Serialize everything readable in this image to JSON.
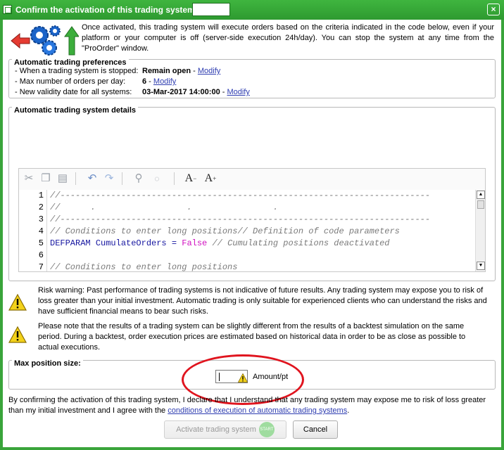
{
  "window": {
    "title": "Confirm the activation of this trading system",
    "close_label": "×"
  },
  "intro": {
    "text": "Once activated, this trading system will execute orders based on the criteria indicated in the code below, even if your platform or your computer is off (server-side execution 24h/day). You can stop the system at any time from the \"ProOrder\" window."
  },
  "preferences": {
    "title": "Automatic trading preferences",
    "rows": [
      {
        "label": "- When a trading system is stopped:",
        "value": "Remain open",
        "link": "Modify"
      },
      {
        "label": "- Max number of orders per day:",
        "value": "6",
        "link": "Modify"
      },
      {
        "label": "- New validity date for all systems:",
        "value": "03-Mar-2017 14:00:00",
        "link": "Modify"
      }
    ],
    "separator": " - "
  },
  "details": {
    "title": "Automatic trading system details",
    "toolbar": [
      "cut-icon",
      "copy-icon",
      "paste-icon",
      "undo-icon",
      "redo-icon",
      "search-icon",
      "comment-icon",
      "decrease-font-icon",
      "increase-font-icon"
    ],
    "line_numbers": [
      "1",
      "2",
      "3",
      "4",
      "5",
      "6",
      "7"
    ],
    "code": {
      "l1": "//-------------------------------------------------------------------------",
      "l2a": "//",
      "l2b": "      .                  .                .",
      "l3": "//-------------------------------------------------------------------------",
      "l4": "// Conditions to enter long positions// Definition of code parameters",
      "l5_kw": "DEFPARAM",
      "l5_name": "CumulateOrders",
      "l5_op": "=",
      "l5_bool": "False",
      "l5_comment": "// Cumulating positions deactivated",
      "l7": "// Conditions to enter long positions"
    }
  },
  "warnings": {
    "risk": "Risk warning: Past performance of trading systems is not indicative of future results. Any trading system may expose you to risk of loss greater than your initial investment. Automatic trading is only suitable for experienced clients who can understand the risks and have sufficient financial means to bear such risks.",
    "backtest": "Please note that the results of a trading system can be slightly different from the results of a backtest simulation on the same period. During a backtest, order execution prices are estimated based on historical data in order to be as close as possible to actual executions."
  },
  "position": {
    "title": "Max position size:",
    "value": "",
    "unit": "Amount/pt"
  },
  "disclaimer": {
    "text": "By confirming the activation of this trading system, I declare that I understand that any trading system may expose me to risk of loss greater than my initial investment and I agree with the ",
    "link": "conditions of execution of automatic trading systems",
    "end": "."
  },
  "buttons": {
    "activate": "Activate trading system",
    "activate_badge": "START",
    "cancel": "Cancel"
  },
  "colors": {
    "title_bar": "#39a43a",
    "link": "#2d3cb0",
    "highlight": "#e0141e"
  }
}
